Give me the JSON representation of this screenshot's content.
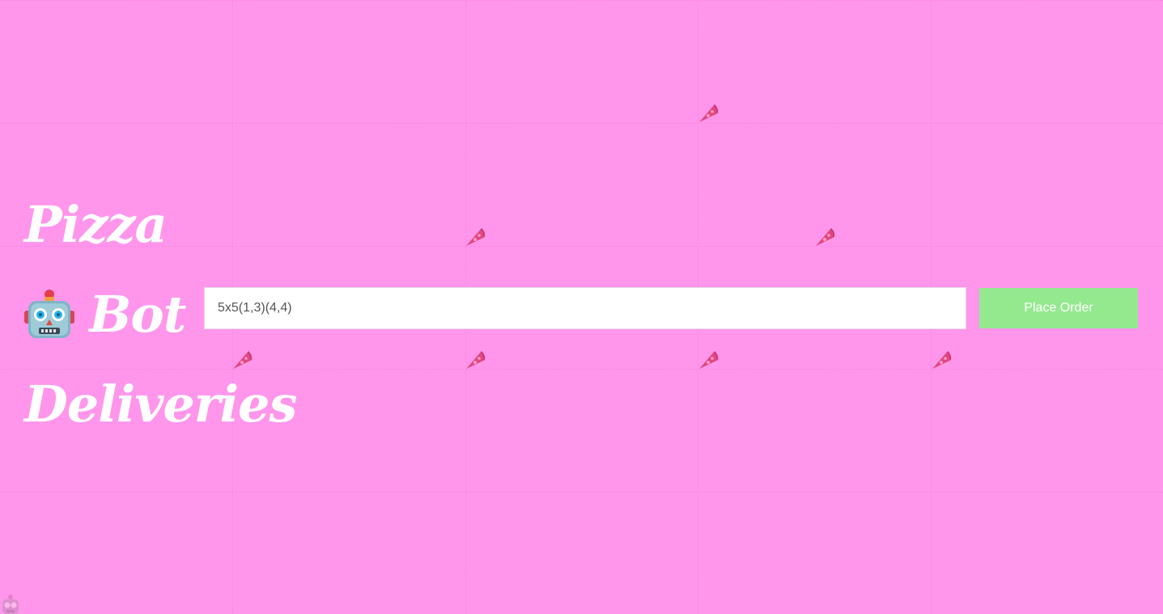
{
  "header": {
    "title_line_1": "Pizza",
    "title_line_2": "Bot",
    "title_line_3": "Deliveries"
  },
  "order_form": {
    "input_value": "5x5(1,3)(4,4)",
    "button_label": "Place Order"
  },
  "grid": {
    "columns": 5,
    "rows": 5,
    "pizza_cells": [
      [
        1,
        3
      ],
      [
        2,
        3
      ],
      [
        3,
        3
      ],
      [
        4,
        3
      ],
      [
        2,
        2
      ],
      [
        3,
        2
      ],
      [
        3,
        1
      ]
    ],
    "line_color": "#ff78dc"
  },
  "colors": {
    "background": "#ff96ec",
    "title_text": "#ffffff",
    "button_background": "#94e98f",
    "button_text": "#ffffff",
    "input_background": "#ffffff"
  },
  "icons": {
    "title_icon": "robot-icon",
    "grid_marker": "pizza-slice-icon",
    "bot_marker": "robot-icon"
  }
}
